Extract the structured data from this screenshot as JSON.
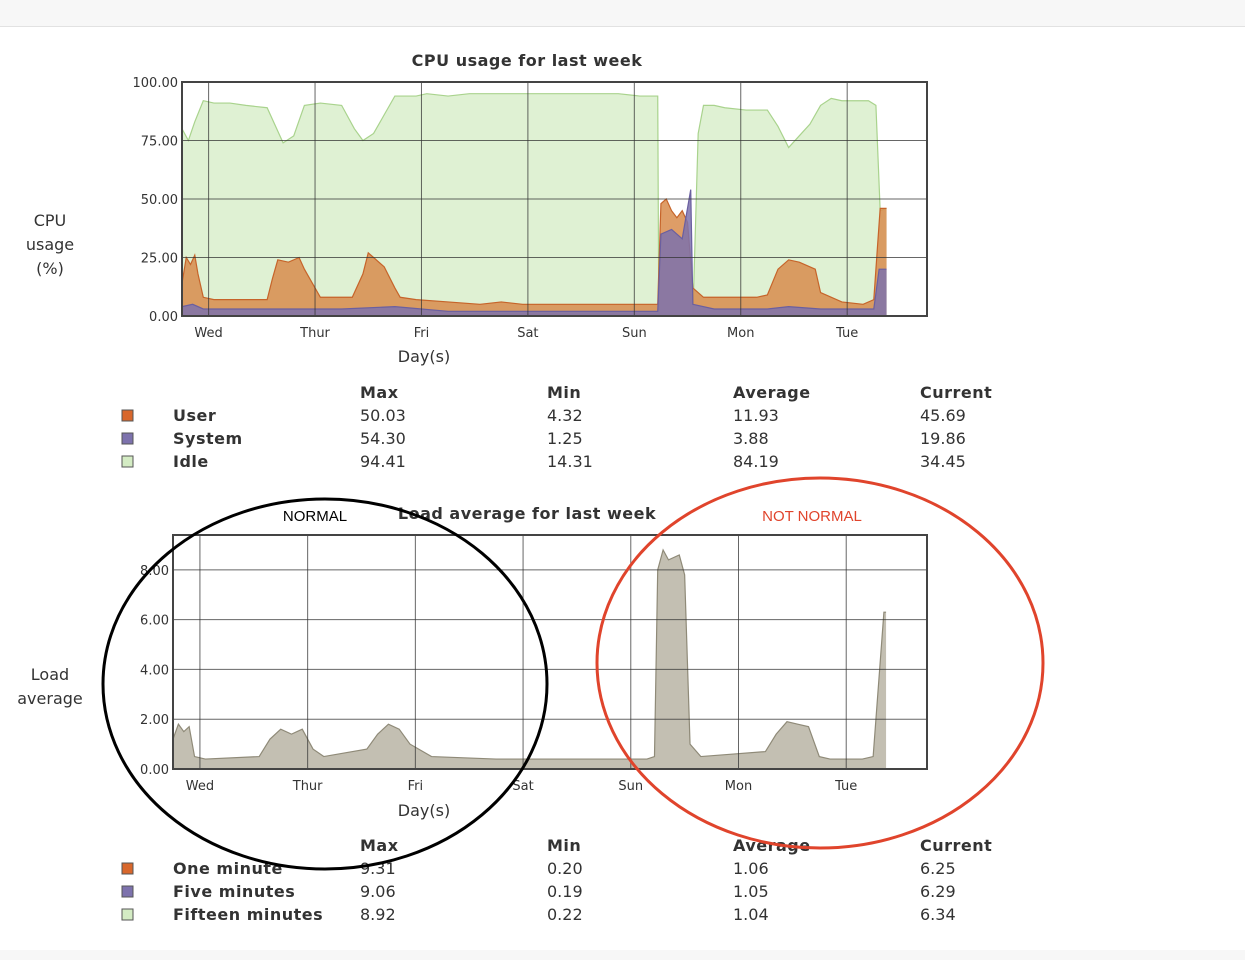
{
  "chart_data": [
    {
      "type": "area",
      "title": "CPU usage for last week",
      "ylabel": "CPU usage (%)",
      "ylabel_lines": [
        "CPU",
        "usage",
        "(%)"
      ],
      "xlabel": "Day(s)",
      "x_ticks": [
        "Wed",
        "Thur",
        "Fri",
        "Sat",
        "Sun",
        "Mon",
        "Tue"
      ],
      "y_ticks": [
        "0.00",
        "25.00",
        "50.00",
        "75.00",
        "100.00"
      ],
      "ylim": [
        0,
        100
      ],
      "x_range_days": [
        0,
        7
      ],
      "grid": true,
      "series": [
        {
          "name": "Idle",
          "color": "#d4ecc4",
          "x": [
            0,
            0.06,
            0.12,
            0.2,
            0.3,
            0.45,
            0.6,
            0.8,
            0.9,
            0.95,
            1.05,
            1.15,
            1.3,
            1.5,
            1.62,
            1.7,
            1.8,
            1.9,
            2.0,
            2.1,
            2.2,
            2.3,
            2.5,
            2.7,
            3.0,
            3.3,
            3.6,
            3.9,
            4.1,
            4.3,
            4.4,
            4.47,
            4.48,
            4.6,
            4.7,
            4.78,
            4.8,
            4.85,
            4.9,
            5.0,
            5.1,
            5.3,
            5.5,
            5.6,
            5.7,
            5.8,
            5.9,
            6.0,
            6.1,
            6.2,
            6.3,
            6.45,
            6.52,
            6.56,
            6.62
          ],
          "values": [
            80,
            75,
            83,
            92,
            91,
            91,
            90,
            89,
            79,
            74,
            77,
            90,
            91,
            90,
            80,
            75,
            78,
            86,
            94,
            94,
            94,
            95,
            94,
            95,
            95,
            95,
            95,
            95,
            95,
            94,
            94,
            94,
            0,
            0,
            0,
            0,
            0,
            78,
            90,
            90,
            89,
            88,
            88,
            81,
            72,
            77,
            82,
            90,
            93,
            92,
            92,
            92,
            90,
            45,
            46
          ]
        },
        {
          "name": "User",
          "color": "#d88c4c",
          "x": [
            0,
            0.04,
            0.08,
            0.12,
            0.15,
            0.2,
            0.3,
            0.6,
            0.8,
            0.85,
            0.9,
            1.0,
            1.1,
            1.15,
            1.3,
            1.6,
            1.7,
            1.75,
            1.8,
            1.9,
            2.0,
            2.05,
            2.2,
            2.5,
            2.8,
            3.0,
            3.2,
            3.5,
            3.9,
            4.2,
            4.4,
            4.47,
            4.5,
            4.55,
            4.6,
            4.65,
            4.7,
            4.75,
            4.8,
            4.9,
            5.0,
            5.2,
            5.4,
            5.5,
            5.6,
            5.7,
            5.8,
            5.95,
            6.0,
            6.2,
            6.4,
            6.5,
            6.52,
            6.56,
            6.62
          ],
          "values": [
            14,
            25,
            22,
            26,
            18,
            8,
            7,
            7,
            7,
            16,
            24,
            23,
            25,
            20,
            8,
            8,
            18,
            27,
            25,
            21,
            12,
            8,
            7,
            6,
            5,
            6,
            5,
            5,
            5,
            5,
            5,
            5,
            48,
            50,
            45,
            42,
            45,
            40,
            12,
            8,
            8,
            8,
            8,
            9,
            20,
            24,
            23,
            20,
            10,
            6,
            5,
            7,
            20,
            46,
            46
          ]
        },
        {
          "name": "System",
          "color": "#7d72ad",
          "x": [
            0,
            0.1,
            0.2,
            0.5,
            1.0,
            1.5,
            2.0,
            2.5,
            3.0,
            3.5,
            4.0,
            4.4,
            4.47,
            4.5,
            4.6,
            4.7,
            4.78,
            4.8,
            5.0,
            5.5,
            5.7,
            6.0,
            6.5,
            6.55,
            6.62
          ],
          "values": [
            4,
            5,
            3,
            3,
            3,
            3,
            4,
            2,
            2,
            2,
            2,
            2,
            2,
            35,
            37,
            33,
            54,
            5,
            3,
            3,
            4,
            3,
            3,
            20,
            20
          ]
        }
      ]
    },
    {
      "type": "area",
      "title": "Load average for last week",
      "ylabel": "Load average",
      "ylabel_lines": [
        "Load",
        "average"
      ],
      "xlabel": "Day(s)",
      "x_ticks": [
        "Wed",
        "Thur",
        "Fri",
        "Sat",
        "Sun",
        "Mon",
        "Tue"
      ],
      "y_ticks": [
        "0.00",
        "2.00",
        "4.00",
        "6.00",
        "8.00"
      ],
      "ylim": [
        0,
        9.4
      ],
      "x_range_days": [
        0,
        7
      ],
      "grid": true,
      "series": [
        {
          "name": "Fifteen minutes",
          "color": "#b8b4a4",
          "x": [
            0,
            0.05,
            0.1,
            0.15,
            0.2,
            0.3,
            0.8,
            0.9,
            1.0,
            1.1,
            1.2,
            1.3,
            1.4,
            1.8,
            1.9,
            2.0,
            2.1,
            2.2,
            2.4,
            3.0,
            3.5,
            4.0,
            4.4,
            4.47,
            4.5,
            4.55,
            4.6,
            4.7,
            4.75,
            4.8,
            4.9,
            5.2,
            5.5,
            5.6,
            5.7,
            5.8,
            5.9,
            6.0,
            6.1,
            6.4,
            6.5,
            6.6,
            6.62
          ],
          "values": [
            1.2,
            1.8,
            1.5,
            1.7,
            0.5,
            0.4,
            0.5,
            1.2,
            1.6,
            1.4,
            1.6,
            0.8,
            0.5,
            0.8,
            1.4,
            1.8,
            1.6,
            1.0,
            0.5,
            0.4,
            0.4,
            0.4,
            0.4,
            0.5,
            8.0,
            8.8,
            8.4,
            8.6,
            7.8,
            1.0,
            0.5,
            0.6,
            0.7,
            1.4,
            1.9,
            1.8,
            1.7,
            0.5,
            0.4,
            0.4,
            0.5,
            6.3,
            6.3
          ]
        }
      ]
    }
  ],
  "cpu_legend": {
    "headers": [
      "Max",
      "Min",
      "Average",
      "Current"
    ],
    "rows": [
      {
        "label": "User",
        "color": "#d8672c",
        "max": "50.03",
        "min": "4.32",
        "avg": "11.93",
        "cur": "45.69"
      },
      {
        "label": "System",
        "color": "#7d72ad",
        "max": "54.30",
        "min": "1.25",
        "avg": "3.88",
        "cur": "19.86"
      },
      {
        "label": "Idle",
        "color": "#d4ecc4",
        "max": "94.41",
        "min": "14.31",
        "avg": "84.19",
        "cur": "34.45"
      }
    ]
  },
  "load_legend": {
    "headers": [
      "Max",
      "Min",
      "Average",
      "Current"
    ],
    "rows": [
      {
        "label": "One minute",
        "color": "#d8672c",
        "max": "9.31",
        "min": "0.20",
        "avg": "1.06",
        "cur": "6.25"
      },
      {
        "label": "Five minutes",
        "color": "#7d72ad",
        "max": "9.06",
        "min": "0.19",
        "avg": "1.05",
        "cur": "6.29"
      },
      {
        "label": "Fifteen minutes",
        "color": "#d4ecc4",
        "max": "8.92",
        "min": "0.22",
        "avg": "1.04",
        "cur": "6.34"
      }
    ]
  },
  "annotations": {
    "normal": {
      "text": "NORMAL",
      "color": "#000000"
    },
    "not_normal": {
      "text": "NOT NORMAL",
      "color": "#e0442c"
    }
  }
}
